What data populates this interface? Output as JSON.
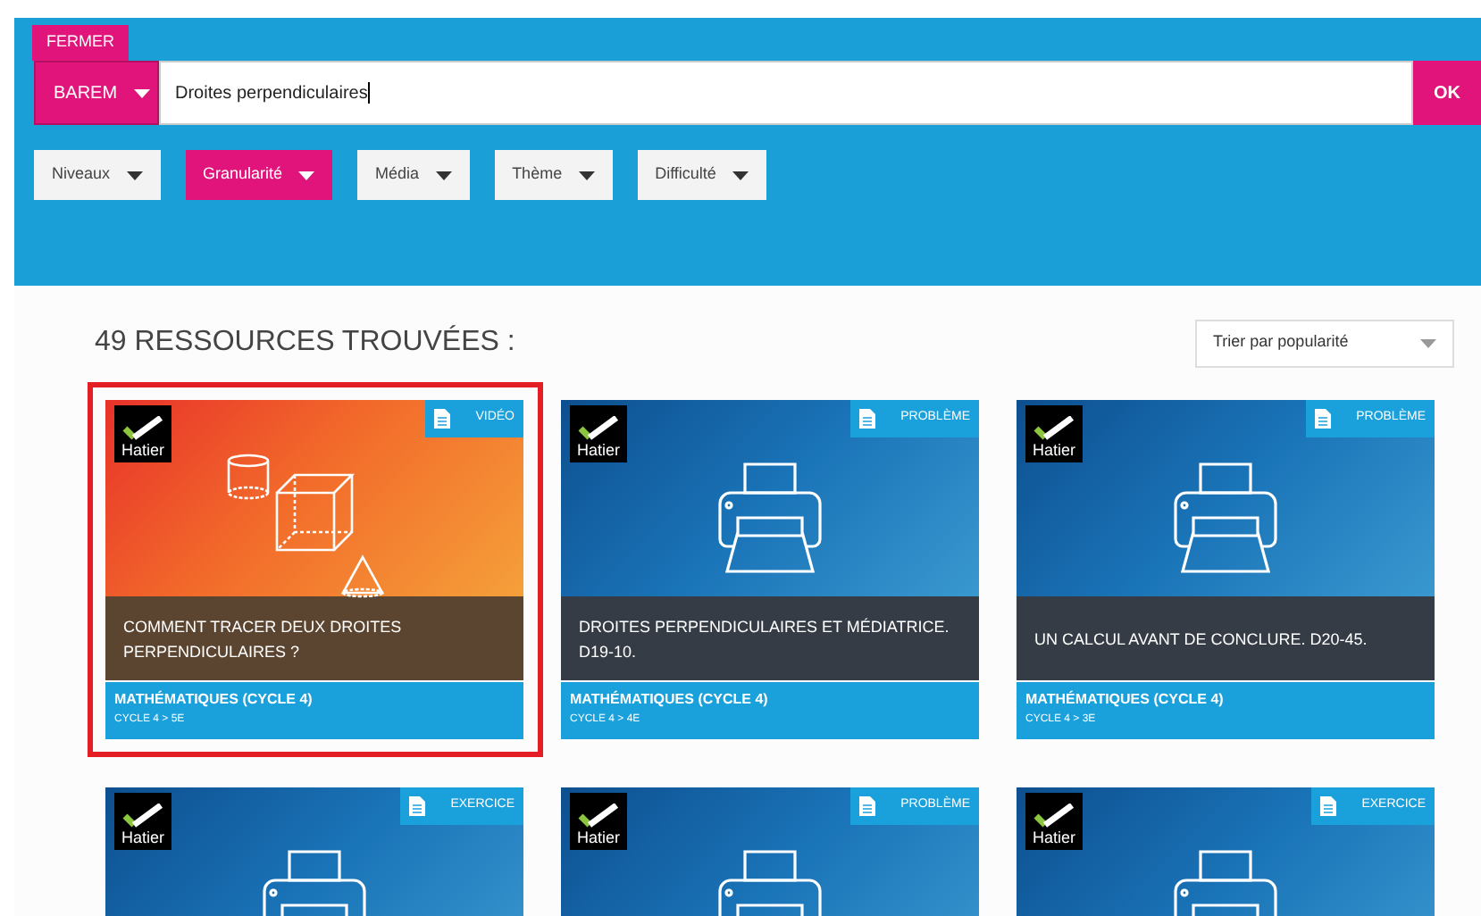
{
  "close_tab": "FERMER",
  "search": {
    "scope": "BAREM",
    "value": "Droites perpendiculaires",
    "submit": "OK"
  },
  "filters": [
    {
      "label": "Niveaux",
      "selected": false
    },
    {
      "label": "Granularité",
      "selected": true
    },
    {
      "label": "Média",
      "selected": false
    },
    {
      "label": "Thème",
      "selected": false
    },
    {
      "label": "Difficulté",
      "selected": false
    }
  ],
  "results_heading": "49 RESSOURCES TROUVÉES :",
  "sort": {
    "value": "Trier par popularité"
  },
  "cards": [
    {
      "kind": "shapes",
      "selected": true,
      "brand": "Hatier",
      "type": "VIDÉO",
      "title": "COMMENT TRACER DEUX DROITES PERPENDICULAIRES ?",
      "subject": "MATHÉMATIQUES (CYCLE 4)",
      "level": "CYCLE 4 > 5E"
    },
    {
      "kind": "printer",
      "selected": false,
      "brand": "Hatier",
      "type": "PROBLÈME",
      "title": "DROITES PERPENDICULAIRES ET MÉDIATRICE. D19-10.",
      "subject": "MATHÉMATIQUES (CYCLE 4)",
      "level": "CYCLE 4 > 4E"
    },
    {
      "kind": "printer",
      "selected": false,
      "brand": "Hatier",
      "type": "PROBLÈME",
      "title": "UN CALCUL AVANT DE CONCLURE. D20-45.",
      "subject": "MATHÉMATIQUES (CYCLE 4)",
      "level": "CYCLE 4 > 3E"
    },
    {
      "kind": "printer",
      "selected": false,
      "brand": "Hatier",
      "type": "EXERCICE"
    },
    {
      "kind": "printer",
      "selected": false,
      "brand": "Hatier",
      "type": "PROBLÈME"
    },
    {
      "kind": "printer",
      "selected": false,
      "brand": "Hatier",
      "type": "EXERCICE"
    }
  ]
}
